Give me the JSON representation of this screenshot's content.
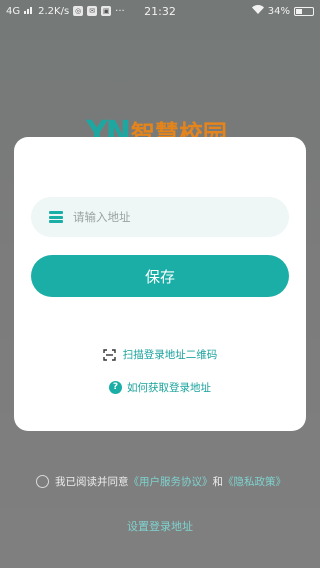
{
  "status_bar": {
    "network": "4G",
    "speed": "2.2K/s",
    "time": "21:32",
    "battery": "34%",
    "icons": [
      "signal-icon",
      "notification-icon",
      "wifi-icon",
      "battery-icon"
    ]
  },
  "logo": {
    "mark": "YN",
    "name": "智慧校园",
    "colors": {
      "mark": "#1ea7a0",
      "name": "#e5841b"
    }
  },
  "modal": {
    "address_input": {
      "placeholder": "请输入地址",
      "value": "",
      "icon": "list-icon"
    },
    "save_label": "保存",
    "scan_label": "扫描登录地址二维码",
    "scan_icon": "scan-icon",
    "help_label": "如何获取登录地址",
    "help_icon": "question-icon"
  },
  "agreement": {
    "prefix": "我已阅读并同意",
    "user_agreement": "《用户服务协议》",
    "conjunction": "和",
    "privacy_policy": "《隐私政策》"
  },
  "setup_link": "设置登录地址",
  "colors": {
    "accent": "#1aaea6",
    "overlay": "rgba(0,0,0,0.5)"
  }
}
